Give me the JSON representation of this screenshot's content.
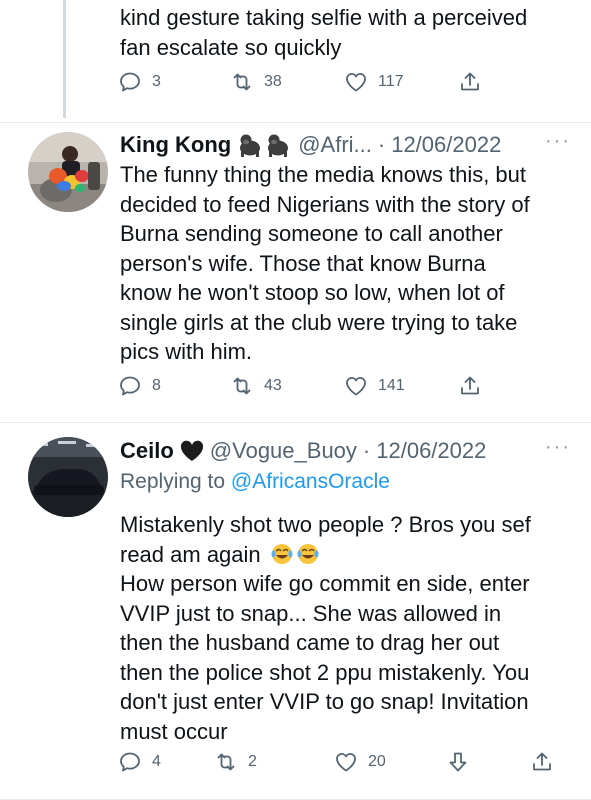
{
  "tweets": [
    {
      "text_lines": [
        "kind gesture taking selfie with a perceived",
        "fan escalate so quickly"
      ],
      "replies": "3",
      "retweets": "38",
      "likes": "117"
    },
    {
      "name": "King Kong",
      "name_emoji": "gorilla-emoji",
      "handle": "@Afri...",
      "dot": "·",
      "date": "12/06/2022",
      "more": "···",
      "text_lines": [
        "The funny thing the media knows this, but",
        "decided to feed Nigerians with the story of",
        "Burna sending someone to call another",
        "person's wife. Those that know Burna",
        "know he won't stoop so low, when lot of",
        "single girls at the club were trying to take",
        "pics with him."
      ],
      "replies": "8",
      "retweets": "43",
      "likes": "141"
    },
    {
      "name": "Ceilo",
      "name_emoji": "black-heart-emoji",
      "handle": "@Vogue_Buoy",
      "dot": "·",
      "date": "12/06/2022",
      "more": "···",
      "replying_prefix": "Replying to",
      "replying_to": "@AfricansOracle",
      "text_lines": [
        "Mistakenly shot two people ? Bros you sef",
        "read am again",
        "How person wife go commit en side, enter",
        "VVIP just to snap... She was allowed in",
        "then the husband came to drag her out",
        "then the police shot 2 ppu mistakenly. You",
        "don't just enter VVIP to go snap! Invitation",
        "must occur"
      ],
      "replies": "4",
      "retweets": "2",
      "likes": "20"
    }
  ]
}
